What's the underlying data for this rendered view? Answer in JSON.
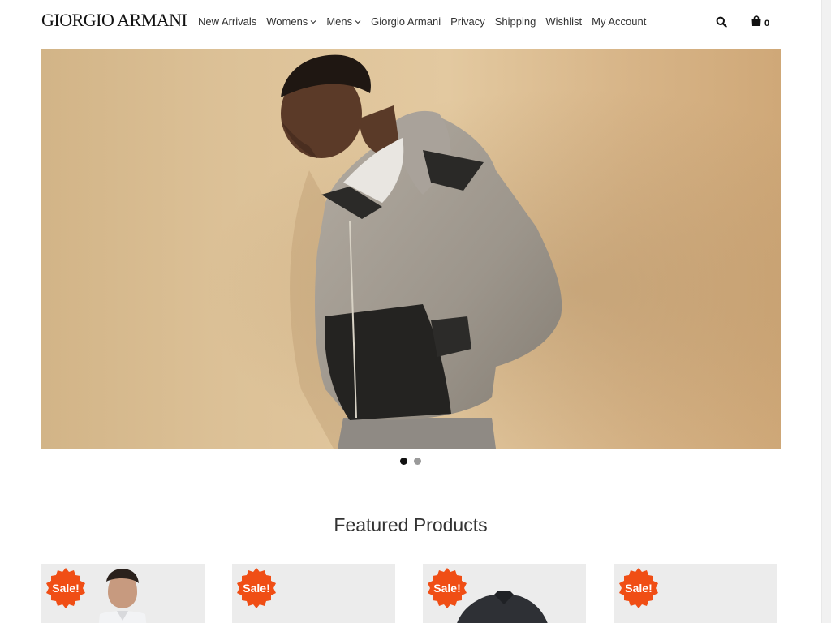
{
  "brand": {
    "logo_text": "GIORGIO ARMANI"
  },
  "nav": {
    "items": [
      {
        "label": "New Arrivals",
        "has_dropdown": false
      },
      {
        "label": "Womens",
        "has_dropdown": true
      },
      {
        "label": "Mens",
        "has_dropdown": true
      },
      {
        "label": "Giorgio Armani",
        "has_dropdown": false
      },
      {
        "label": "Privacy",
        "has_dropdown": false
      },
      {
        "label": "Shipping",
        "has_dropdown": false
      },
      {
        "label": "Wishlist",
        "has_dropdown": false
      },
      {
        "label": "My Account",
        "has_dropdown": false
      }
    ]
  },
  "header_actions": {
    "search_icon": "search-icon",
    "cart_icon": "shopping-bag-icon",
    "cart_count": "0"
  },
  "hero": {
    "slide_count": 2,
    "active_slide": 1,
    "image": "model in grey and black hooded jacket"
  },
  "featured": {
    "title": "Featured Products",
    "products": [
      {
        "badge": "Sale!",
        "image": "man in white shirt"
      },
      {
        "badge": "Sale!",
        "image": ""
      },
      {
        "badge": "Sale!",
        "image": "dark jacket"
      },
      {
        "badge": "Sale!",
        "image": ""
      }
    ]
  },
  "colors": {
    "sale_badge": "#f04e15",
    "text": "#333333",
    "dot_active": "#111111",
    "dot_inactive": "#9a9a9a"
  }
}
